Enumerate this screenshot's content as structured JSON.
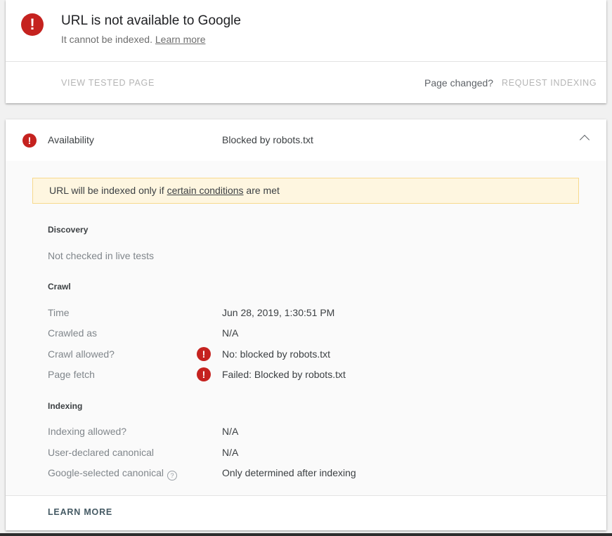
{
  "status_card": {
    "title": "URL is not available to Google",
    "subtitle_text": "It cannot be indexed.",
    "subtitle_link": "Learn more",
    "view_tested_page": "VIEW TESTED PAGE",
    "page_changed": "Page changed?",
    "request_indexing": "REQUEST INDEXING",
    "error_glyph": "!"
  },
  "availability": {
    "label": "Availability",
    "value": "Blocked by robots.txt",
    "warning": {
      "prefix": "URL will be indexed only if",
      "link": "certain conditions",
      "suffix": "are met"
    },
    "discovery": {
      "heading": "Discovery",
      "note": "Not checked in live tests"
    },
    "crawl": {
      "heading": "Crawl",
      "rows": [
        {
          "label": "Time",
          "value": "Jun 28, 2019, 1:30:51 PM"
        },
        {
          "label": "Crawled as",
          "value": "N/A"
        },
        {
          "label": "Crawl allowed?",
          "value": "No: blocked by robots.txt"
        },
        {
          "label": "Page fetch",
          "value": "Failed: Blocked by robots.txt"
        }
      ]
    },
    "indexing": {
      "heading": "Indexing",
      "rows": [
        {
          "label": "Indexing allowed?",
          "value": "N/A"
        },
        {
          "label": "User-declared canonical",
          "value": "N/A"
        },
        {
          "label": "Google-selected canonical",
          "value": "Only determined after indexing"
        }
      ],
      "help_glyph": "?"
    },
    "learn_more": "LEARN MORE"
  },
  "colors": {
    "error": "#c5221f",
    "warning_bg": "#fef6e0",
    "warning_border": "#f7d98d"
  },
  "icons": [
    "error-icon",
    "chevron-up-icon",
    "help-icon"
  ]
}
